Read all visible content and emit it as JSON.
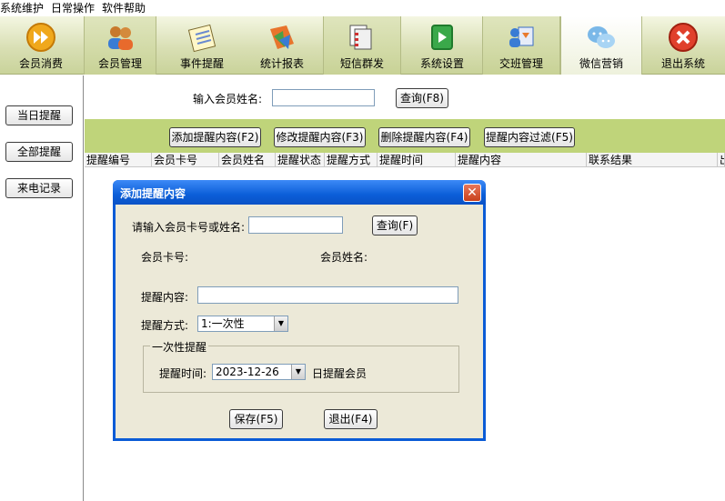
{
  "menu": [
    "系统维护",
    "日常操作",
    "软件帮助"
  ],
  "toolbar": [
    {
      "label": "会员消费",
      "icon": "fast-forward-icon"
    },
    {
      "label": "会员管理",
      "icon": "members-icon"
    },
    {
      "label": "事件提醒",
      "icon": "notepad-icon"
    },
    {
      "label": "统计报表",
      "icon": "chart-icon"
    },
    {
      "label": "短信群发",
      "icon": "documents-icon"
    },
    {
      "label": "系统设置",
      "icon": "settings-icon"
    },
    {
      "label": "交班管理",
      "icon": "handover-icon"
    },
    {
      "label": "微信营销",
      "icon": "wechat-icon"
    },
    {
      "label": "退出系统",
      "icon": "exit-icon"
    }
  ],
  "sidebar": [
    "当日提醒",
    "全部提醒",
    "来电记录"
  ],
  "search": {
    "label": "输入会员姓名:",
    "button": "查询(F8)",
    "value": ""
  },
  "actions": [
    "添加提醒内容(F2)",
    "修改提醒内容(F3)",
    "删除提醒内容(F4)",
    "提醒内容过滤(F5)"
  ],
  "columns": [
    "提醒编号",
    "会员卡号",
    "会员姓名",
    "提醒状态",
    "提醒方式",
    "提醒时间",
    "提醒内容",
    "联系结果",
    "出"
  ],
  "dialog": {
    "title": "添加提醒内容",
    "close": "✕",
    "card_prompt": "请输入会员卡号或姓名:",
    "query_button": "查询(F)",
    "card_label": "会员卡号:",
    "name_label": "会员姓名:",
    "content_label": "提醒内容:",
    "method_label": "提醒方式:",
    "method_value": "1:一次性",
    "group_title": "一次性提醒",
    "time_label": "提醒时间:",
    "time_value": "2023-12-26",
    "time_suffix": "日提醒会员",
    "save_button": "保存(F5)",
    "exit_button": "退出(F4)"
  },
  "colors": {
    "actionbar": "#bfd47a",
    "title": "#0a5bd6"
  }
}
